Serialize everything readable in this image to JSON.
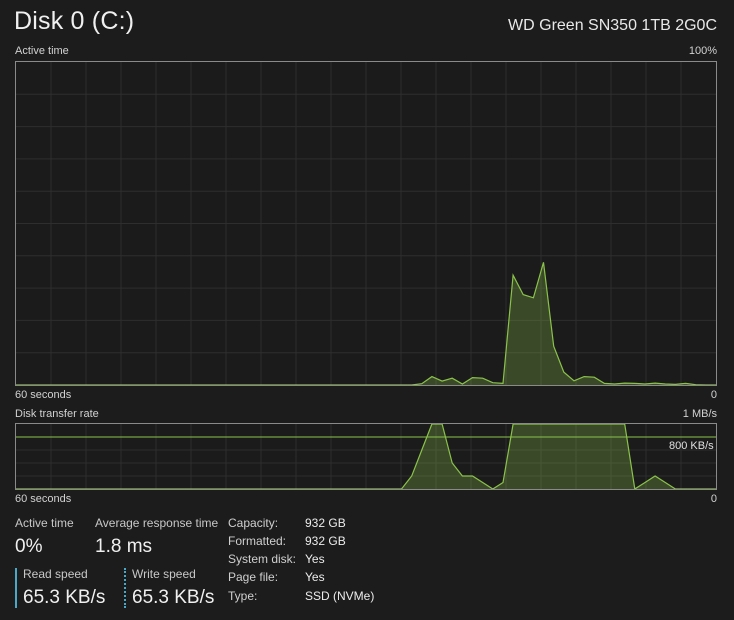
{
  "header": {
    "title": "Disk 0 (C:)",
    "model": "WD Green SN350 1TB 2G0C"
  },
  "active_time_graph": {
    "label": "Active time",
    "max_label": "100%",
    "time_label": "60 seconds",
    "min_label": "0",
    "samples": [
      0,
      0,
      0,
      0,
      0,
      0,
      0,
      0,
      0,
      0,
      0,
      0,
      0,
      0,
      0,
      0,
      0,
      0,
      0,
      0,
      0,
      0,
      0,
      0,
      0,
      0,
      0,
      0,
      0,
      0,
      0,
      0,
      0,
      0,
      0,
      0,
      0,
      0,
      0,
      0,
      0.4,
      2.6,
      1.2,
      2.1,
      0.3,
      2.3,
      2.1,
      0.7,
      0.5,
      34,
      28,
      27,
      38,
      12,
      4,
      1.3,
      2.6,
      2.4,
      0.5,
      0.3,
      0.6,
      0.5,
      0.3,
      0.6,
      0.3,
      0.2,
      0.5,
      0.1,
      0,
      0
    ],
    "accent": "#8bc34a"
  },
  "transfer_graph": {
    "label": "Disk transfer rate",
    "max_label": "1 MB/s",
    "line_label": "800 KB/s",
    "line_fraction": 0.8,
    "time_label": "60 seconds",
    "min_label": "0",
    "samples": [
      0,
      0,
      0,
      0,
      0,
      0,
      0,
      0,
      0,
      0,
      0,
      0,
      0,
      0,
      0,
      0,
      0,
      0,
      0,
      0,
      0,
      0,
      0,
      0,
      0,
      0,
      0,
      0,
      0,
      0,
      0,
      0,
      0,
      0,
      0,
      0,
      0,
      0,
      0,
      0.2,
      0.6,
      1,
      1,
      0.4,
      0.2,
      0.2,
      0.1,
      0,
      0.1,
      1,
      1,
      1,
      1,
      1,
      1,
      1,
      1,
      1,
      1,
      1,
      1,
      0,
      0.1,
      0.2,
      0.1,
      0,
      0,
      0,
      0,
      0
    ],
    "accent": "#8bc34a"
  },
  "stats": {
    "active_time": {
      "caption": "Active time",
      "value": "0%"
    },
    "avg_response": {
      "caption": "Average response time",
      "value": "1.8 ms"
    },
    "read_speed": {
      "caption": "Read speed",
      "value": "65.3 KB/s"
    },
    "write_speed": {
      "caption": "Write speed",
      "value": "65.3 KB/s"
    }
  },
  "properties": [
    {
      "key": "Capacity:",
      "value": "932 GB"
    },
    {
      "key": "Formatted:",
      "value": "932 GB"
    },
    {
      "key": "System disk:",
      "value": "Yes"
    },
    {
      "key": "Page file:",
      "value": "Yes"
    },
    {
      "key": "Type:",
      "value": "SSD (NVMe)"
    }
  ]
}
